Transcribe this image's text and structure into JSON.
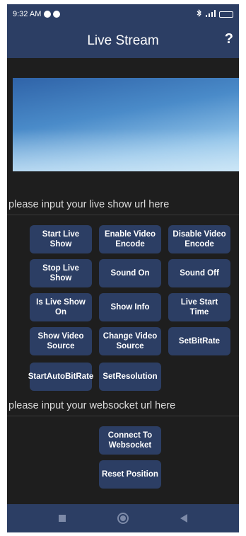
{
  "status_bar": {
    "time": "9:32 AM",
    "battery_color": "#5fd36a"
  },
  "app_bar": {
    "title": "Live Stream",
    "help_label": "?"
  },
  "inputs": {
    "live_url_placeholder": "please input your live show url here",
    "websocket_url_placeholder": "please input your websocket url here"
  },
  "buttons": {
    "start_live_show": "Start Live Show",
    "enable_video_encode": "Enable Video Encode",
    "disable_video_encode": "Disable Video Encode",
    "stop_live_show": "Stop Live Show",
    "sound_on": "Sound On",
    "sound_off": "Sound Off",
    "is_live_show_on": "Is Live Show On",
    "show_info": "Show Info",
    "live_start_time": "Live Start Time",
    "show_video_source": "Show Video Source",
    "change_video_source": "Change Video Source",
    "set_bit_rate": "SetBitRate",
    "start_auto_bit_rate": "StartAutoBitRate",
    "set_resolution": "SetResolution",
    "connect_to_websocket": "Connect To Websocket",
    "reset_position": "Reset Position"
  },
  "colors": {
    "app_bar": "#2c3e64",
    "button": "#2c3e64",
    "background": "#1e1e1e"
  },
  "icons": {
    "status_left": [
      "app-notification-icon",
      "app-notification-icon"
    ],
    "status_right": [
      "bluetooth-icon",
      "signal-icon",
      "battery-icon"
    ],
    "nav": [
      "recent-apps-icon",
      "home-icon",
      "back-icon"
    ]
  }
}
